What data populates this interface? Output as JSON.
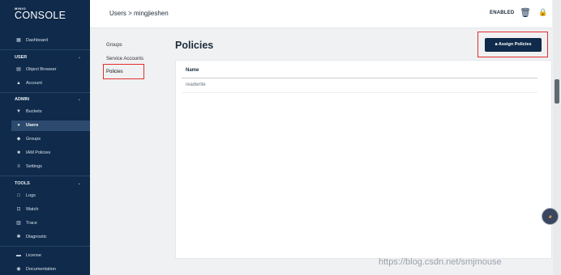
{
  "logo": {
    "min": "MINIO",
    "console": "CONSOLE"
  },
  "sidebar": {
    "dashboard": "Dashboard",
    "user_section": "USER",
    "user_items": [
      "Object Browser",
      "Account"
    ],
    "admin_section": "ADMIN",
    "admin_items": [
      "Buckets",
      "Users",
      "Groups",
      "IAM Policies",
      "Settings"
    ],
    "tools_section": "TOOLS",
    "tools_items": [
      "Logs",
      "Watch",
      "Trace",
      "Diagnostic"
    ],
    "bottom_items": [
      "License",
      "Documentation"
    ],
    "active_item": "Users"
  },
  "header": {
    "breadcrumb": "Users > mingjieshen",
    "status": "ENABLED"
  },
  "submenu": [
    "Groups",
    "Service Accounts",
    "Policies"
  ],
  "main": {
    "title": "Policies",
    "assign_button": "Assign Policies",
    "table": {
      "columns": [
        "Name"
      ],
      "rows": [
        [
          "readwrite"
        ]
      ]
    }
  },
  "watermark": "https://blog.csdn.net/smjmouse",
  "colors": {
    "sidebar": "#0f2a4a",
    "accent": "#0f2a4a",
    "highlight_border": "#e1302b"
  }
}
